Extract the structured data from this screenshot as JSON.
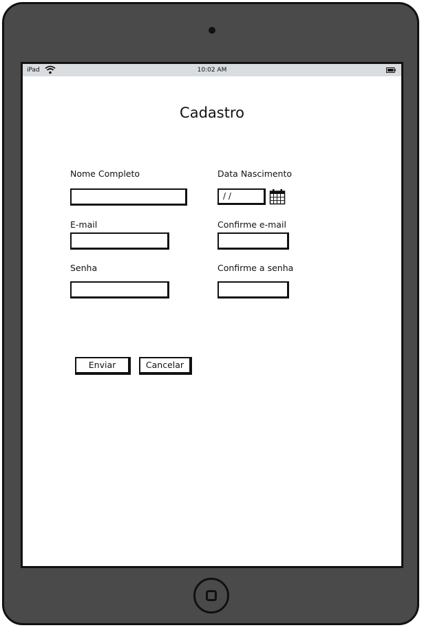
{
  "status_bar": {
    "carrier": "iPad",
    "time": "10:02 AM",
    "wifi_icon": "wifi-icon",
    "battery_icon": "battery-icon"
  },
  "form": {
    "title": "Cadastro",
    "nome_label": "Nome Completo",
    "nome_value": "",
    "data_label": "Data Nascimento",
    "data_value": " /  /",
    "calendar_icon": "calendar-icon",
    "email_label": "E-mail",
    "email_value": "",
    "confirm_email_label": "Confirme e-mail",
    "confirm_email_value": "",
    "senha_label": "Senha",
    "senha_value": "",
    "confirm_senha_label": "Confirme a senha",
    "confirm_senha_value": ""
  },
  "buttons": {
    "enviar": "Enviar",
    "cancelar": "Cancelar"
  },
  "device": {
    "home_button_icon": "home-button-icon",
    "camera_icon": "camera-icon"
  }
}
